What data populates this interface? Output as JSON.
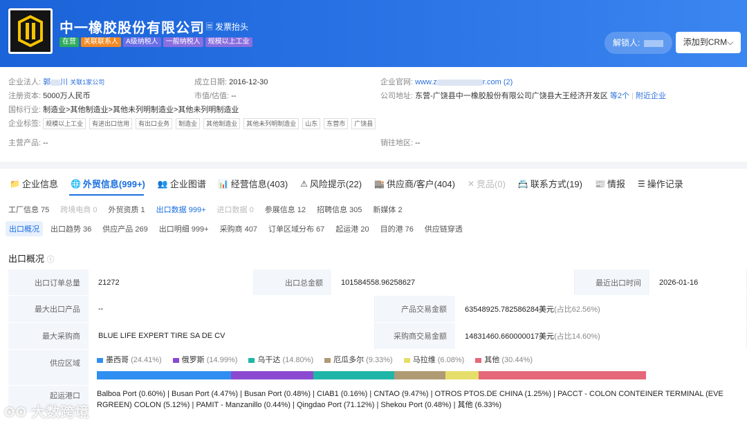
{
  "header": {
    "company_name": "中一橡胶股份有限公司",
    "invoice_label": "发票抬头",
    "tags": [
      {
        "text": "在营",
        "color": "#2dab5b"
      },
      {
        "text": "关联联系人",
        "color": "#f08a24"
      },
      {
        "text": "A级纳税人",
        "color": "#6b6fe6"
      },
      {
        "text": "一般纳税人",
        "color": "#8a6fe0"
      },
      {
        "text": "规模以上工业",
        "color": "#8a6fe0"
      }
    ],
    "unlocker_label": "解锁人:",
    "add_crm": "添加到CRM",
    "add_crm_caret": "⌵"
  },
  "info": {
    "legal_person_label": "企业法人:",
    "legal_person_value": "郭",
    "legal_person_value_tail": "川",
    "legal_person_link": "关联1家公司",
    "founded_label": "成立日期:",
    "founded_value": "2016-12-30",
    "website_label": "企业官网:",
    "website_value_a": "www.z",
    "website_value_b": "r.com (2)",
    "capital_label": "注册资本:",
    "capital_value": "5000万人民币",
    "market_label": "市值/估值:",
    "market_value": "--",
    "address_label": "公司地址:",
    "address_value": "东营-广饶县中一橡胶股份有限公司广饶县大王经济开发区",
    "address_more": "等2个",
    "address_nearby": "附近企业",
    "industry_label": "国标行业:",
    "industry_value": "制造业>其他制造业>其他未列明制造业>其他未列明制造业",
    "tags_label": "企业标签:",
    "tags": [
      "规模以上工业",
      "有进出口信用",
      "有出口业务",
      "制造业",
      "其他制造业",
      "其他未列明制造业",
      "山东",
      "东营市",
      "广饶县"
    ],
    "product_label": "主营产品:",
    "product_value": "--",
    "region_label": "销往地区:",
    "region_value": "--"
  },
  "tabs": [
    {
      "icon": "📁",
      "label": "企业信息",
      "state": ""
    },
    {
      "icon": "🌐",
      "label": "外贸信息(999+)",
      "state": "act"
    },
    {
      "icon": "👥",
      "label": "企业图谱",
      "state": ""
    },
    {
      "icon": "📊",
      "label": "经营信息(403)",
      "state": ""
    },
    {
      "icon": "⚠",
      "label": "风险提示(22)",
      "state": ""
    },
    {
      "icon": "🏬",
      "label": "供应商/客户(404)",
      "state": ""
    },
    {
      "icon": "✕",
      "label": "竞品(0)",
      "state": "dis"
    },
    {
      "icon": "📇",
      "label": "联系方式(19)",
      "state": ""
    },
    {
      "icon": "📰",
      "label": "情报",
      "state": ""
    },
    {
      "icon": "☰",
      "label": "操作记录",
      "state": ""
    }
  ],
  "subtabs": [
    {
      "label": "工厂信息 75",
      "state": ""
    },
    {
      "label": "跨境电商 0",
      "state": "dis"
    },
    {
      "label": "外贸资质 1",
      "state": ""
    },
    {
      "label": "出口数据 999+",
      "state": "act"
    },
    {
      "label": "进口数据 0",
      "state": "dis"
    },
    {
      "label": "参展信息 12",
      "state": ""
    },
    {
      "label": "招聘信息 305",
      "state": ""
    },
    {
      "label": "新媒体 2",
      "state": ""
    }
  ],
  "subtabs2": [
    {
      "label": "出口概况",
      "state": "act"
    },
    {
      "label": "出口趋势 36",
      "state": ""
    },
    {
      "label": "供应产品 269",
      "state": ""
    },
    {
      "label": "出口明细 999+",
      "state": ""
    },
    {
      "label": "采购商 407",
      "state": ""
    },
    {
      "label": "订单区域分布 67",
      "state": ""
    },
    {
      "label": "起运港 20",
      "state": ""
    },
    {
      "label": "目的港 76",
      "state": ""
    },
    {
      "label": "供应链穿透",
      "state": ""
    }
  ],
  "section_title": "出口概况",
  "overview": {
    "order_total_label": "出口订单总量",
    "order_total_value": "21272",
    "amount_label": "出口总金额",
    "amount_value": "101584558.96258627",
    "last_label": "最近出口时间",
    "last_value": "2026-01-16",
    "max_product_label": "最大出口产品",
    "max_product_value": "--",
    "product_amount_label": "产品交易金额",
    "product_amount_value": "63548925.782586284美元",
    "product_amount_pct": "(占比62.56%)",
    "max_buyer_label": "最大采购商",
    "max_buyer_value": "BLUE LIFE EXPERT TIRE SA DE CV",
    "buyer_amount_label": "采购商交易金额",
    "buyer_amount_value": "14831460.660000017美元",
    "buyer_amount_pct": "(占比14.60%)",
    "region_label": "供应区域",
    "port_label": "起运港口",
    "ports_line1": "Balboa Port (0.60%) | Busan Port (4.47%) | Busan Port (0.48%) | CIAB1 (0.16%) | CNTAO (9.47%) | OTROS PTOS.DE CHINA (1.25%) | PACCT - COLON CONTEINER TERMINAL (EVE",
    "ports_line2": "RGREEN) COLON (5.12%) | PAMIT - Manzanillo (0.44%) | Qingdao Port (71.12%) | Shekou Port (0.48%) | 其他 (6.33%)"
  },
  "chart_data": {
    "type": "bar",
    "title": "供应区域",
    "categories": [
      "墨西哥",
      "俄罗斯",
      "乌干达",
      "厄瓜多尔",
      "马拉维",
      "其他"
    ],
    "values": [
      24.41,
      14.99,
      14.8,
      9.33,
      6.08,
      30.44
    ],
    "labels": [
      "(24.41%)",
      "(14.99%)",
      "(14.80%)",
      "(9.33%)",
      "(6.08%)",
      "(30.44%)"
    ],
    "colors": [
      "#2f8ff0",
      "#8a49d0",
      "#1fb6a8",
      "#b09a74",
      "#e6de6a",
      "#e4687a"
    ],
    "orientation": "stacked-horizontal"
  },
  "watermark": "大数跨境"
}
